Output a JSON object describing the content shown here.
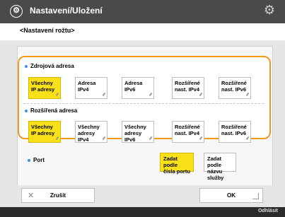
{
  "window": {
    "title": "Nastavení/Uložení",
    "title_icon": "settings-circle-icon",
    "gear_icon": "gear-icon"
  },
  "page": {
    "subtitle": "<Nastavení rožtu>"
  },
  "source_address": {
    "label": "Zdrojová adresa",
    "options": [
      {
        "label": "Všechny IP adresy",
        "selected": true
      },
      {
        "label": "Adresa IPv4",
        "selected": false
      },
      {
        "label": "Adresa IPv6",
        "selected": false
      },
      {
        "label": "Rozšířené nast. IPv4",
        "selected": false
      },
      {
        "label": "Rozšířené nast. IPv6",
        "selected": false
      }
    ]
  },
  "dest_address": {
    "label": "Rozšířená adresa",
    "options": [
      {
        "label": "Všechny IP adresy",
        "selected": true
      },
      {
        "label": "Všechny adresy IPv4",
        "selected": false
      },
      {
        "label": "Všechny adresy IPv6",
        "selected": false
      },
      {
        "label": "Rozšířené nast. IPv4",
        "selected": false
      },
      {
        "label": "Rozšířené nast. IPv6",
        "selected": false
      }
    ]
  },
  "port": {
    "label": "Port",
    "options": [
      {
        "label": "Zadat podle čísla portu",
        "selected": true
      },
      {
        "label": "Zadat podle názvu služby",
        "selected": false
      }
    ]
  },
  "actions": {
    "cancel": "Zrušit",
    "ok": "OK"
  },
  "footer": {
    "logout": "Odhlásit"
  },
  "colors": {
    "accent_selected": "#f9e11a",
    "focus_border": "#ef9a1c",
    "titlebar": "#4a4a4a"
  }
}
